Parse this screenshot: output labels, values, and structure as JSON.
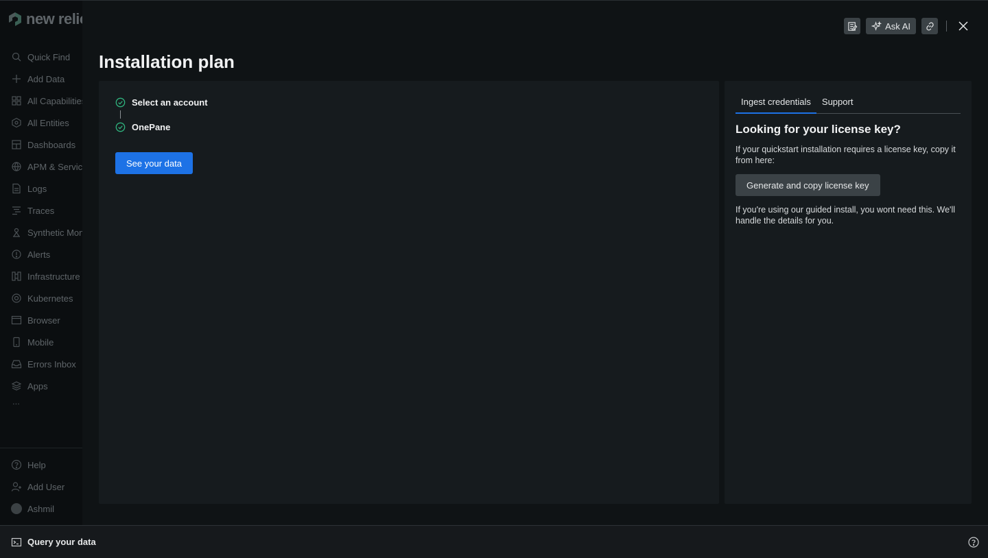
{
  "brand": {
    "logo_text": "new relic"
  },
  "sidebar": {
    "items": [
      {
        "label": "Quick Find",
        "icon": "search-icon"
      },
      {
        "label": "Add Data",
        "icon": "plus-icon"
      },
      {
        "label": "All Capabilities",
        "icon": "grid-icon"
      },
      {
        "label": "All Entities",
        "icon": "entities-icon"
      },
      {
        "label": "Dashboards",
        "icon": "dashboard-icon"
      },
      {
        "label": "APM & Services",
        "icon": "globe-icon"
      },
      {
        "label": "Logs",
        "icon": "logs-icon"
      },
      {
        "label": "Traces",
        "icon": "traces-icon"
      },
      {
        "label": "Synthetic Monitoring",
        "icon": "synthetic-icon"
      },
      {
        "label": "Alerts",
        "icon": "alert-icon"
      },
      {
        "label": "Infrastructure",
        "icon": "infrastructure-icon"
      },
      {
        "label": "Kubernetes",
        "icon": "kubernetes-icon"
      },
      {
        "label": "Browser",
        "icon": "browser-icon"
      },
      {
        "label": "Mobile",
        "icon": "mobile-icon"
      },
      {
        "label": "Errors Inbox",
        "icon": "inbox-icon"
      },
      {
        "label": "Apps",
        "icon": "apps-icon"
      }
    ],
    "more_label": "...",
    "bottom": {
      "help_label": "Help",
      "add_user_label": "Add User",
      "user_name": "Ashmil"
    }
  },
  "modal": {
    "title": "Installation plan",
    "ask_ai_label": "Ask AI",
    "steps": [
      {
        "label": "Select an account",
        "status": "complete"
      },
      {
        "label": "OnePane",
        "status": "complete"
      }
    ],
    "primary_button": "See your data",
    "side_panel": {
      "tabs": [
        {
          "label": "Ingest credentials",
          "active": true
        },
        {
          "label": "Support",
          "active": false
        }
      ],
      "heading": "Looking for your license key?",
      "intro_text": "If your quickstart installation requires a license key, copy it from here:",
      "button_label": "Generate and copy license key",
      "footer_text": "If you're using our guided install, you wont need this. We'll handle the details for you."
    }
  },
  "bottombar": {
    "query_label": "Query your data"
  },
  "colors": {
    "accent": "#1d72e6",
    "success": "#2fb37e"
  }
}
